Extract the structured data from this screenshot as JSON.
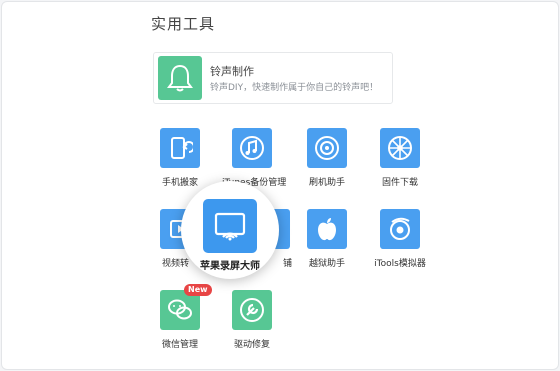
{
  "section": {
    "title": "实用工具"
  },
  "featured": {
    "title": "铃声制作",
    "description": "铃声DIY，快速制作属于你自己的铃声吧！",
    "icon": "bell-icon"
  },
  "tools": [
    {
      "label": "手机搬家",
      "icon": "phone-transfer-icon",
      "color": "#4a9ff0"
    },
    {
      "label": "iTunes备份管理",
      "icon": "music-note-icon",
      "color": "#4a9ff0"
    },
    {
      "label": "刷机助手",
      "icon": "gear-flash-icon",
      "color": "#4a9ff0"
    },
    {
      "label": "固件下载",
      "icon": "firmware-wheel-icon",
      "color": "#4a9ff0"
    },
    {
      "label": "视频转",
      "icon": "video-icon",
      "color": "#4a9ff0"
    },
    {
      "label": "铺",
      "icon": "tool-icon",
      "color": "#4a9ff0"
    },
    {
      "label": "越狱助手",
      "icon": "apple-icon",
      "color": "#4a9ff0"
    },
    {
      "label": "iTools模拟器",
      "icon": "simulator-icon",
      "color": "#4a9ff0"
    },
    {
      "label": "微信管理",
      "icon": "wechat-icon",
      "color": "#57c794",
      "badge": "New"
    },
    {
      "label": "驱动修复",
      "icon": "wrench-icon",
      "color": "#57c794"
    }
  ],
  "spotlight": {
    "label": "苹果录屏大师",
    "icon": "screen-mirror-icon",
    "color": "#3d98ee"
  }
}
